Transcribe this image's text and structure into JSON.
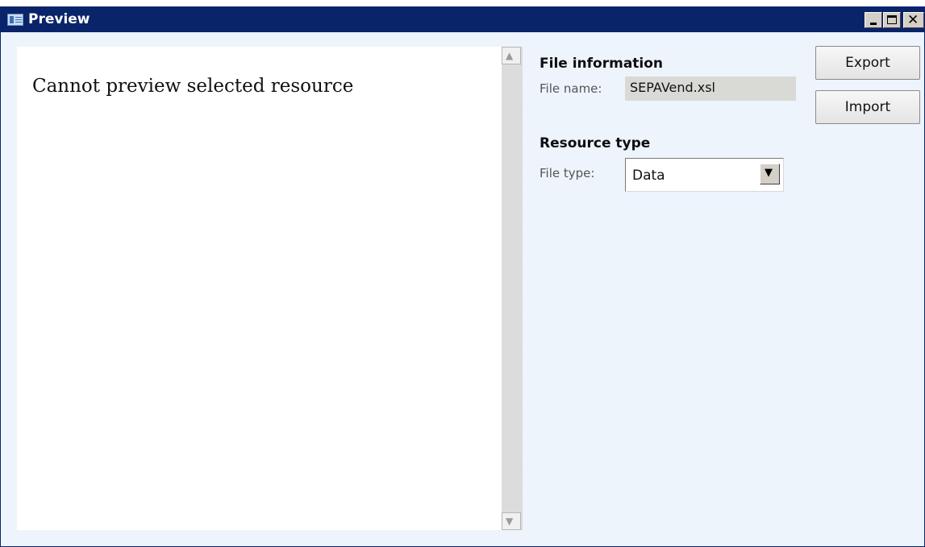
{
  "window": {
    "title": "Preview"
  },
  "preview": {
    "message": "Cannot preview selected resource"
  },
  "file_info": {
    "heading": "File information",
    "file_name_label": "File name:",
    "file_name_value": "SEPAVend.xsl"
  },
  "resource_type": {
    "heading": "Resource type",
    "file_type_label": "File type:",
    "file_type_value": "Data"
  },
  "actions": {
    "export_label": "Export",
    "import_label": "Import"
  },
  "colors": {
    "titlebar": "#0a246a",
    "panel_background": "#edf4fc"
  }
}
